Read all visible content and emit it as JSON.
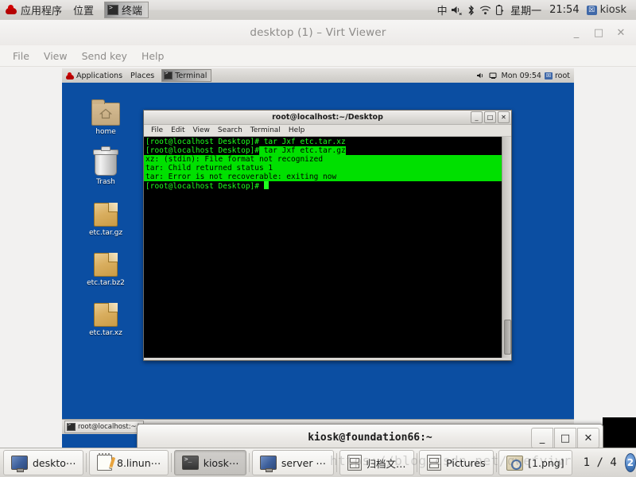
{
  "host_panel": {
    "menus": [
      {
        "name": "applications-menu",
        "label": "应用程序"
      },
      {
        "name": "places-menu",
        "label": "位置"
      }
    ],
    "active_task": {
      "label": "终端",
      "icon": "terminal-icon"
    },
    "tray": [
      {
        "name": "input-method-indicator",
        "glyph": "中"
      },
      {
        "name": "volume-icon",
        "glyph": "🔊"
      },
      {
        "name": "bluetooth-icon",
        "glyph": "✳"
      },
      {
        "name": "wifi-icon",
        "glyph": "📶"
      },
      {
        "name": "battery-icon",
        "glyph": "🔋"
      }
    ],
    "day": "星期一",
    "clock": "21:54",
    "user": "kiosk"
  },
  "virt_viewer": {
    "title": "desktop (1) – Virt Viewer",
    "window_buttons": {
      "minimize": "_",
      "maximize": "□",
      "close": "✕"
    },
    "menus": [
      "File",
      "View",
      "Send key",
      "Help"
    ]
  },
  "guest_panel": {
    "menus": [
      {
        "name": "applications-menu",
        "label": "Applications"
      },
      {
        "name": "places-menu",
        "label": "Places"
      }
    ],
    "active_task": {
      "label": "Terminal",
      "icon": "terminal-icon"
    },
    "clock": "Mon 09:54",
    "user": "root"
  },
  "guest_desktop": {
    "background_color": "#0b4ea2",
    "icons": [
      {
        "name": "desktop-icon-home",
        "label": "home",
        "type": "folder"
      },
      {
        "name": "desktop-icon-trash",
        "label": "Trash",
        "type": "trash"
      },
      {
        "name": "desktop-icon-etc-tar-gz",
        "label": "etc.tar.gz",
        "type": "archive"
      },
      {
        "name": "desktop-icon-etc-tar-bz2",
        "label": "etc.tar.bz2",
        "type": "archive"
      },
      {
        "name": "desktop-icon-etc-tar-xz",
        "label": "etc.tar.xz",
        "type": "archive"
      }
    ],
    "taskbar_button": "root@localhost:~/"
  },
  "guest_terminal": {
    "title": "root@localhost:~/Desktop",
    "window_buttons": {
      "minimize": "_",
      "maximize": "□",
      "close": "✕"
    },
    "menus": [
      "File",
      "Edit",
      "View",
      "Search",
      "Terminal",
      "Help"
    ],
    "colors": {
      "background": "#000000",
      "foreground": "#1eff1e",
      "selection_bg": "#00e000",
      "selection_fg": "#000000"
    },
    "lines": [
      {
        "selected": false,
        "segments": [
          {
            "text": "[root@localhost Desktop]# tar Jxf etc.tar.xz",
            "sel": false
          }
        ]
      },
      {
        "selected": false,
        "segments": [
          {
            "text": "[root@localhost Desktop]#",
            "sel": false
          },
          {
            "text": " tar Jxf etc.tar.gz",
            "sel": true
          }
        ]
      },
      {
        "selected": true,
        "segments": [
          {
            "text": "xz: (stdin): File format not recognized",
            "sel": true
          }
        ]
      },
      {
        "selected": true,
        "segments": [
          {
            "text": "tar: Child returned status 1",
            "sel": true
          }
        ]
      },
      {
        "selected": true,
        "segments": [
          {
            "text": "tar: Error is not recoverable: exiting now",
            "sel": true
          }
        ]
      },
      {
        "selected": false,
        "segments": [
          {
            "text": "[root@localhost Desktop]# ",
            "sel": false
          }
        ],
        "cursor": true
      }
    ]
  },
  "kiosk_window": {
    "title": "kiosk@foundation66:~",
    "window_buttons": {
      "minimize": "_",
      "maximize": "□",
      "close": "✕"
    }
  },
  "host_taskbar": {
    "buttons": [
      {
        "name": "taskbar-item-desktop",
        "label": "deskto⋯",
        "icon": "monitor-icon",
        "active": false
      },
      {
        "name": "taskbar-item-8linux",
        "label": "8.linun⋯",
        "icon": "notepad-icon",
        "active": false
      },
      {
        "name": "taskbar-item-kiosk",
        "label": "kiosk⋯",
        "icon": "terminal-icon",
        "active": true
      },
      {
        "name": "taskbar-item-server",
        "label": "server ⋯",
        "icon": "monitor-icon",
        "active": false
      },
      {
        "name": "taskbar-item-archive-folder",
        "label": "归档文…",
        "icon": "file-cabinet-icon",
        "active": false
      },
      {
        "name": "taskbar-item-pictures",
        "label": "Pictures",
        "icon": "file-cabinet-icon",
        "active": false
      },
      {
        "name": "taskbar-item-image-viewer",
        "label": "[1.png]",
        "icon": "image-viewer-icon",
        "active": false
      }
    ],
    "counter": "1 / 4",
    "workspace": "2"
  },
  "watermark": "https://blog.csdn.net/qwefyiwr"
}
